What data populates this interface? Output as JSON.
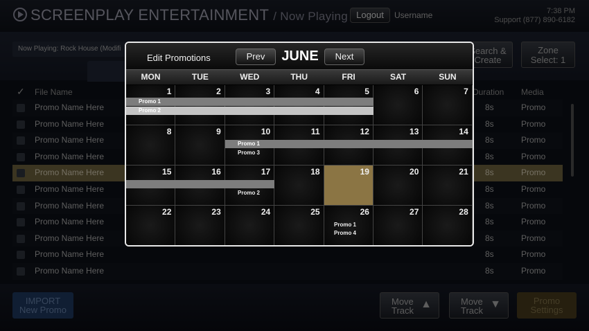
{
  "header": {
    "brand": "SCREENPLAY ENTERTAINMENT",
    "section": "/ Now Playing",
    "logout": "Logout",
    "username": "Username",
    "time": "7:38 PM",
    "support": "Support (877) 890-6182"
  },
  "toolbar": {
    "now_playing": "Now Playing: Rock House (Modifi",
    "search_line1": "Search &",
    "search_line2": "Create",
    "zone_line1": "Zone",
    "zone_line2": "Select: 1"
  },
  "list": {
    "headers": {
      "name": "File Name",
      "duration": "Duration",
      "media": "Media"
    },
    "rows": [
      {
        "name": "Promo Name Here",
        "duration": "8s",
        "media": "Promo"
      },
      {
        "name": "Promo Name Here",
        "duration": "8s",
        "media": "Promo"
      },
      {
        "name": "Promo Name Here",
        "duration": "8s",
        "media": "Promo"
      },
      {
        "name": "Promo Name Here",
        "duration": "8s",
        "media": "Promo"
      },
      {
        "name": "Promo Name Here",
        "duration": "8s",
        "media": "Promo"
      },
      {
        "name": "Promo Name Here",
        "duration": "8s",
        "media": "Promo"
      },
      {
        "name": "Promo Name Here",
        "duration": "8s",
        "media": "Promo"
      },
      {
        "name": "Promo Name Here",
        "duration": "8s",
        "media": "Promo"
      },
      {
        "name": "Promo Name Here",
        "duration": "8s",
        "media": "Promo"
      },
      {
        "name": "Promo Name Here",
        "duration": "8s",
        "media": "Promo"
      },
      {
        "name": "Promo Name Here",
        "duration": "8s",
        "media": "Promo"
      }
    ]
  },
  "bottom": {
    "import_line1": "IMPORT",
    "import_line2": "New Promo",
    "move_up_line1": "Move",
    "move_up_line2": "Track",
    "move_down_line1": "Move",
    "move_down_line2": "Track",
    "promo_line1": "Promo",
    "promo_line2": "Settings"
  },
  "modal": {
    "title": "Edit Promotions",
    "prev": "Prev",
    "month": "JUNE",
    "next": "Next",
    "days": [
      "MON",
      "TUE",
      "WED",
      "THU",
      "FRI",
      "SAT",
      "SUN"
    ],
    "weeks": [
      [
        "1",
        "2",
        "3",
        "4",
        "5",
        "6",
        "7"
      ],
      [
        "8",
        "9",
        "10",
        "11",
        "12",
        "13",
        "14"
      ],
      [
        "15",
        "16",
        "17",
        "18",
        "19",
        "20",
        "21"
      ],
      [
        "22",
        "23",
        "24",
        "25",
        "26",
        "27",
        "28"
      ]
    ],
    "today": "19",
    "promos": {
      "w1a": "Promo 1",
      "w1b": "Promo 2",
      "w2a": "Promo 1",
      "w2b": "Promo 3",
      "w3": "Promo 2",
      "w4a": "Promo 1",
      "w4b": "Promo 4"
    }
  },
  "colors": {
    "selected_row": "#766a43",
    "today": "#8b7544",
    "import": "#203d66"
  }
}
